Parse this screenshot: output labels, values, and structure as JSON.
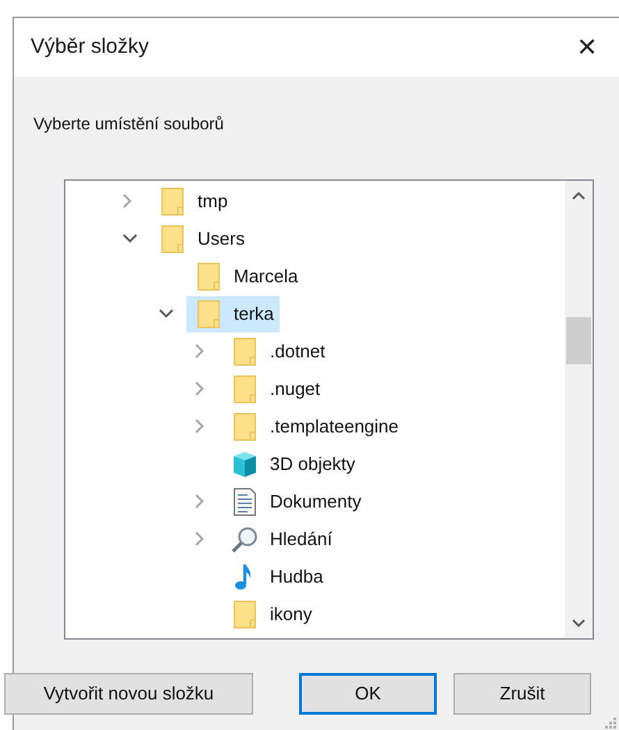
{
  "window": {
    "title": "Výběr složky",
    "close": "✕"
  },
  "prompt": "Vyberte umístění souborů",
  "tree": [
    {
      "label": "tmp",
      "kind": "folder",
      "expanded": false,
      "selected": false
    },
    {
      "label": "Users",
      "kind": "folder",
      "expanded": true,
      "selected": false,
      "children": [
        {
          "label": "Marcela",
          "kind": "folder",
          "selected": false
        },
        {
          "label": "terka",
          "kind": "folder",
          "expanded": true,
          "selected": true,
          "children": [
            {
              "label": ".dotnet",
              "kind": "folder",
              "expanded": false,
              "selected": false
            },
            {
              "label": ".nuget",
              "kind": "folder",
              "expanded": false,
              "selected": false
            },
            {
              "label": ".templateengine",
              "kind": "folder",
              "expanded": false,
              "selected": false
            },
            {
              "label": "3D objekty",
              "kind": "cube",
              "selected": false
            },
            {
              "label": "Dokumenty",
              "kind": "document",
              "expanded": false,
              "selected": false
            },
            {
              "label": "Hledání",
              "kind": "search",
              "expanded": false,
              "selected": false
            },
            {
              "label": "Hudba",
              "kind": "music",
              "selected": false
            },
            {
              "label": "ikony",
              "kind": "folder",
              "selected": false
            }
          ]
        }
      ]
    }
  ],
  "buttons": [
    {
      "label": "Vytvořit novou složku",
      "default": false
    },
    {
      "label": "OK",
      "default": true
    },
    {
      "label": "Zrušit",
      "default": false
    }
  ]
}
